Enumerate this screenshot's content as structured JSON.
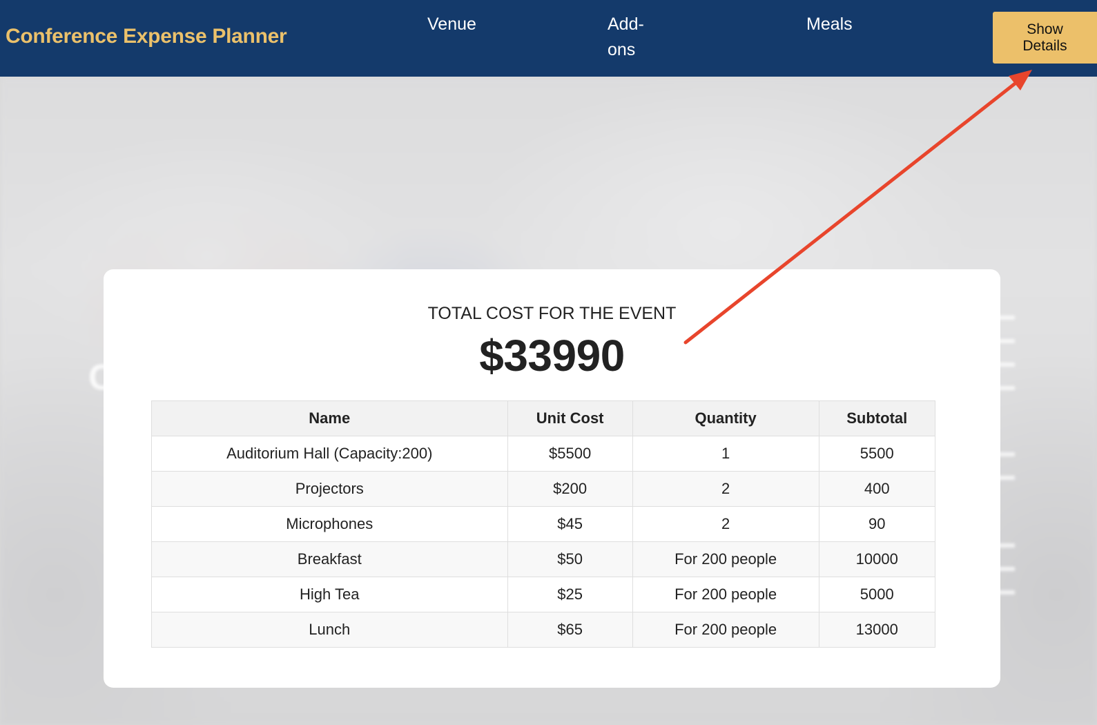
{
  "app": {
    "title": "Conference Expense Planner"
  },
  "nav": {
    "items": [
      {
        "label": "Venue"
      },
      {
        "label": "Add-ons"
      },
      {
        "label": "Meals"
      }
    ],
    "show_details_label": "Show Details"
  },
  "summary": {
    "total_label": "TOTAL COST FOR THE EVENT",
    "total_value": "$33990"
  },
  "table": {
    "headers": [
      "Name",
      "Unit Cost",
      "Quantity",
      "Subtotal"
    ],
    "rows": [
      {
        "name": "Auditorium Hall (Capacity:200)",
        "unit_cost": "$5500",
        "quantity": "1",
        "subtotal": "5500"
      },
      {
        "name": "Projectors",
        "unit_cost": "$200",
        "quantity": "2",
        "subtotal": "400"
      },
      {
        "name": "Microphones",
        "unit_cost": "$45",
        "quantity": "2",
        "subtotal": "90"
      },
      {
        "name": "Breakfast",
        "unit_cost": "$50",
        "quantity": "For 200 people",
        "subtotal": "10000"
      },
      {
        "name": "High Tea",
        "unit_cost": "$25",
        "quantity": "For 200 people",
        "subtotal": "5000"
      },
      {
        "name": "Lunch",
        "unit_cost": "$65",
        "quantity": "For 200 people",
        "subtotal": "13000"
      }
    ]
  },
  "colors": {
    "navbar": "#143a6b",
    "brand_text": "#ebc16b",
    "show_details_button": "#ecc06a",
    "annotation_arrow": "#e8452c"
  },
  "annotation": {
    "type": "arrow",
    "points_to": "show-details-button"
  }
}
